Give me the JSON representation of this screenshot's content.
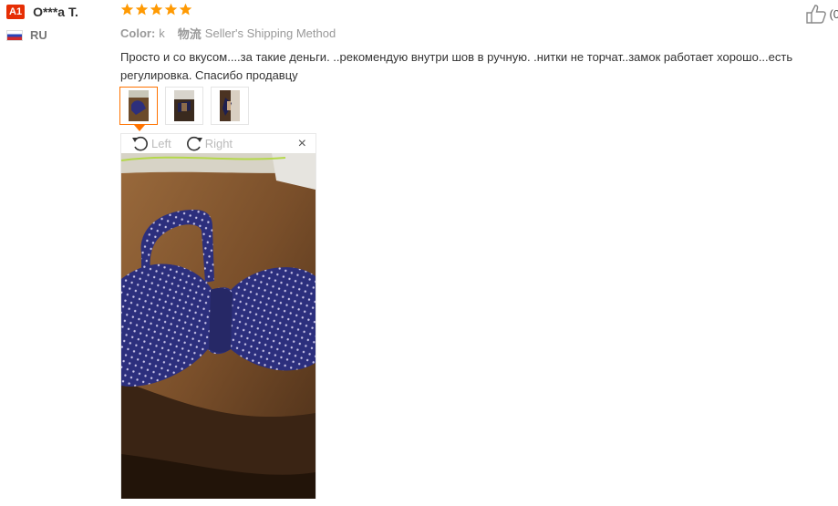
{
  "user": {
    "level": "A1",
    "name": "O***a T.",
    "country": "RU"
  },
  "review": {
    "stars": 5,
    "color_label": "Color:",
    "color_value": "k",
    "shipping_label": "物流",
    "shipping_value": "Seller's Shipping Method",
    "text": "Просто и со вкусом....за такие деньги. ..рекомендую внутри шов в ручную. .нитки не торчат..замок работает хорошо...есть регулировка. Спасибо продавцу"
  },
  "helpful": {
    "count_text": "(0"
  },
  "viewer": {
    "rotate_left": "Left",
    "rotate_right": "Right",
    "close": "×"
  },
  "colors": {
    "accent": "#ff7300",
    "star": "#ff9a03",
    "badge": "#e62e04",
    "muted": "#999999"
  },
  "icons": [
    "thumbs-up-icon",
    "rotate-left-icon",
    "rotate-right-icon",
    "close-icon",
    "star-icon",
    "flag-ru-icon"
  ]
}
